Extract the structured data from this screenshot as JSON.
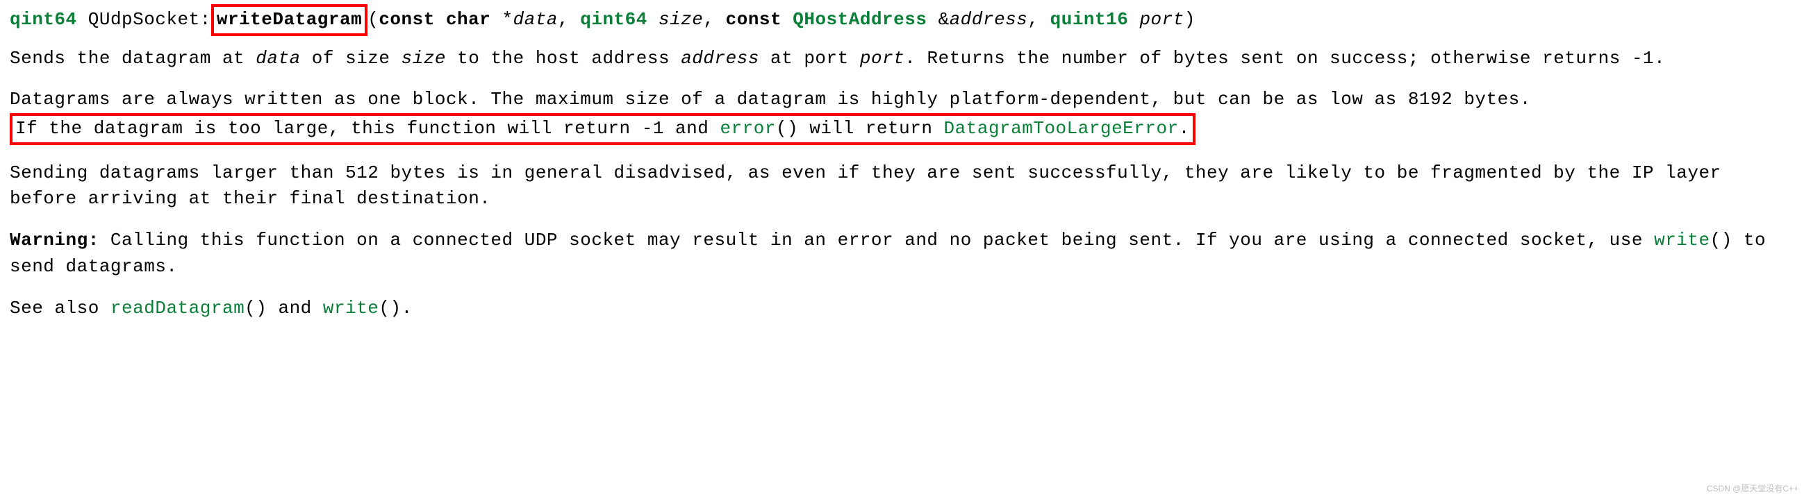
{
  "signature": {
    "ret_type": "qint64",
    "class": "QUdpSocket",
    "scope": ":",
    "method": "writeDatagram",
    "open": "(",
    "p1_kw": "const",
    "p1_type": "char",
    "p1_ptr": "*",
    "p1_name": "data",
    "sep1": ", ",
    "p2_type": "qint64",
    "p2_name": "size",
    "sep2": ", ",
    "p3_kw": "const",
    "p3_type": "QHostAddress",
    "p3_ref": "&",
    "p3_name": "address",
    "sep3": ", ",
    "p4_type": "quint16",
    "p4_name": "port",
    "close": ")"
  },
  "para1": {
    "a": "Sends the datagram at ",
    "b": "data",
    "c": " of size ",
    "d": "size",
    "e": " to the host address ",
    "f": "address",
    "g": " at port ",
    "h": "port",
    "i": ". Returns the number of bytes sent on success; otherwise returns -1."
  },
  "para2": {
    "a": "Datagrams are always written as one block. The maximum size of a datagram is highly platform-dependent, but can be as low as 8192 bytes. ",
    "b": "If the datagram is too large, this function will return -1 and ",
    "c": "error",
    "d": "() will return ",
    "e": "DatagramTooLargeError",
    "f": "."
  },
  "para3": "Sending datagrams larger than 512 bytes is in general disadvised, as even if they are sent successfully, they are likely to be fragmented by the IP layer before arriving at their final destination.",
  "para4": {
    "a": "Warning:",
    "b": " Calling this function on a connected UDP socket may result in an error and no packet being sent. If you are using a connected socket, use ",
    "c": "write",
    "d": "() to send datagrams."
  },
  "para5": {
    "a": "See also ",
    "b": "readDatagram",
    "c": "() and ",
    "d": "write",
    "e": "()."
  },
  "watermark": "CSDN @愿天堂没有C++"
}
